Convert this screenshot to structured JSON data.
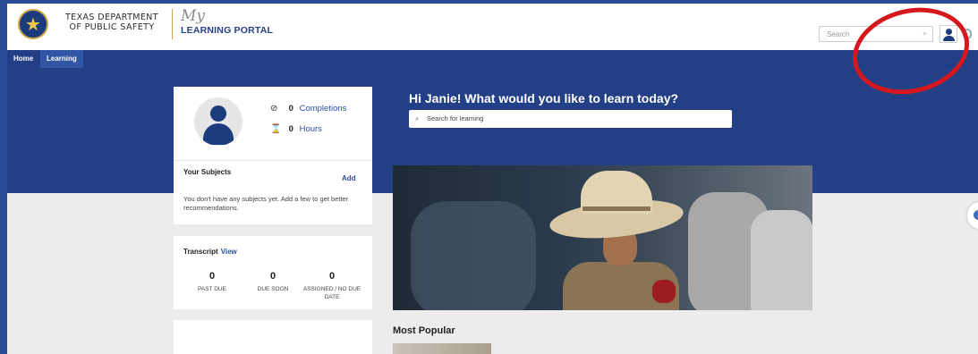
{
  "header": {
    "agency_line1": "TEXAS DEPARTMENT",
    "agency_line2": "OF PUBLIC SAFETY",
    "brand_script": "My",
    "brand_name": "LEARNING PORTAL",
    "search_placeholder": "Search",
    "search_icon": "⌕"
  },
  "nav": {
    "items": [
      {
        "label": "Home"
      },
      {
        "label": "Learning"
      }
    ]
  },
  "profile": {
    "completions_count": "0",
    "completions_label": "Completions",
    "hours_count": "0",
    "hours_label": "Hours",
    "completions_icon": "⊘",
    "hours_icon": "⌛"
  },
  "subjects": {
    "title": "Your Subjects",
    "add_label": "Add",
    "empty_text": "You don't have any subjects yet. Add a few to get better recommendations."
  },
  "transcript": {
    "title": "Transcript",
    "view_label": "View",
    "columns": [
      {
        "count": "0",
        "label": "PAST DUE"
      },
      {
        "count": "0",
        "label": "DUE SOON"
      },
      {
        "count": "0",
        "label": "ASSIGNED / NO DUE DATE"
      }
    ]
  },
  "main": {
    "greeting": "Hi Janie! What would you like to learn today?",
    "search_placeholder": "Search for learning",
    "search_icon": "⌕",
    "most_popular": "Most Popular"
  },
  "colors": {
    "navy": "#233f86",
    "link_blue": "#2a4f9f",
    "annotation_red": "#d6171e"
  }
}
